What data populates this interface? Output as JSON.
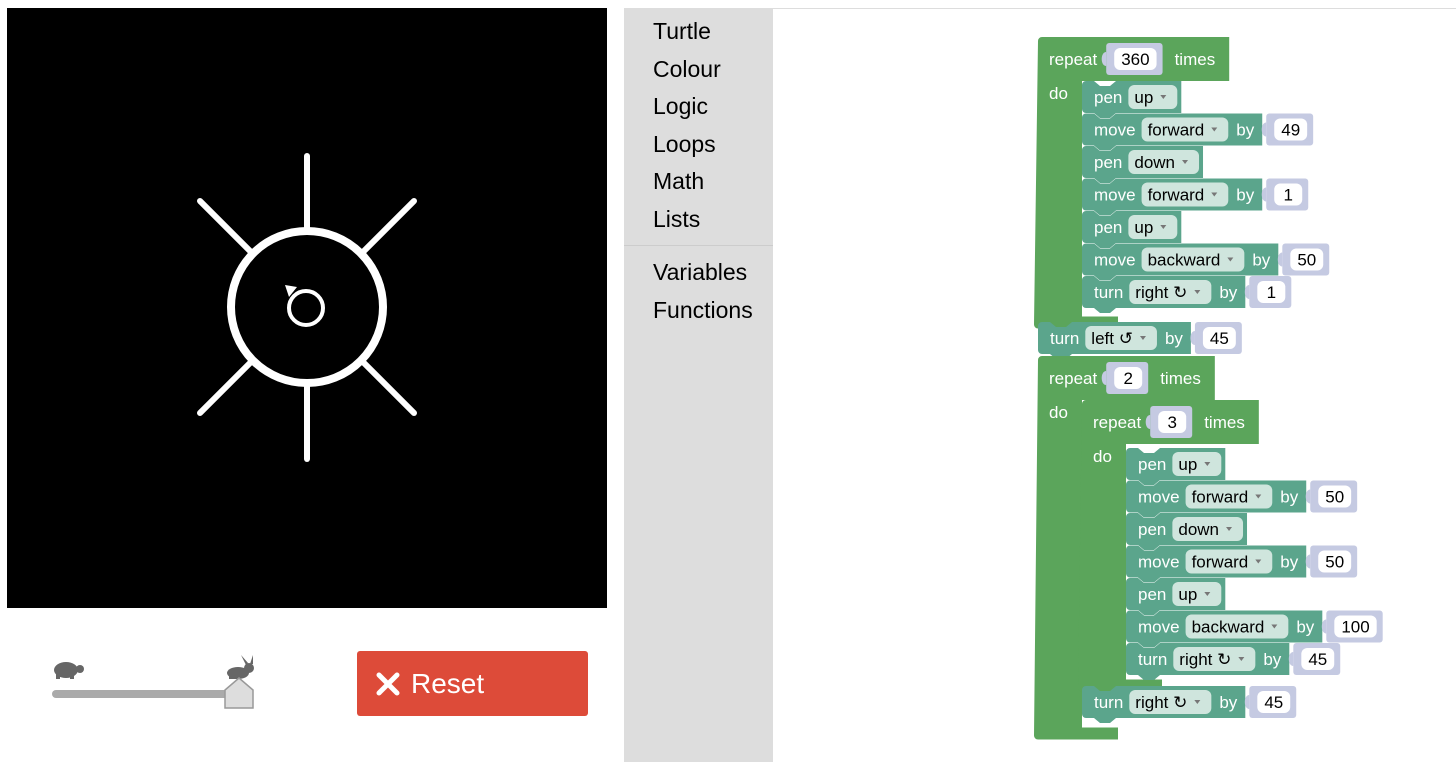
{
  "speed": {
    "slow_icon": "turtle-icon",
    "fast_icon": "rabbit-icon",
    "level": 1.0
  },
  "reset": {
    "label": "Reset",
    "icon": "x-icon"
  },
  "toolbox": {
    "categories": [
      "Turtle",
      "Colour",
      "Logic",
      "Loops",
      "Math",
      "Lists",
      "Variables",
      "Functions"
    ]
  },
  "colors": {
    "loop": "#5ba55b",
    "turtle": "#5ba58c",
    "value": "#c5cae2",
    "dropdown": "#cfe5dd",
    "reset": "#dd4b39",
    "toolbox": "#dddddd",
    "canvas": "#000000"
  },
  "words": {
    "repeat": "repeat",
    "times": "times",
    "do": "do",
    "pen": "pen",
    "move": "move",
    "turn": "turn",
    "by": "by"
  },
  "program": {
    "outer_repeat": {
      "count": "360",
      "body": [
        {
          "verb": "pen",
          "option": "up"
        },
        {
          "verb": "move",
          "option": "forward",
          "by": "49"
        },
        {
          "verb": "pen",
          "option": "down"
        },
        {
          "verb": "move",
          "option": "forward",
          "by": "1"
        },
        {
          "verb": "pen",
          "option": "up"
        },
        {
          "verb": "move",
          "option": "backward",
          "by": "50"
        },
        {
          "verb": "turn",
          "option": "right ↻",
          "by": "1"
        }
      ]
    },
    "turn_left": {
      "verb": "turn",
      "option": "left ↺",
      "by": "45"
    },
    "second_repeat": {
      "count": "2",
      "inner_repeat": {
        "count": "3",
        "body": [
          {
            "verb": "pen",
            "option": "up"
          },
          {
            "verb": "move",
            "option": "forward",
            "by": "50"
          },
          {
            "verb": "pen",
            "option": "down"
          },
          {
            "verb": "move",
            "option": "forward",
            "by": "50"
          },
          {
            "verb": "pen",
            "option": "up"
          },
          {
            "verb": "move",
            "option": "backward",
            "by": "100"
          },
          {
            "verb": "turn",
            "option": "right ↻",
            "by": "45"
          }
        ]
      },
      "after": {
        "verb": "turn",
        "option": "right ↻",
        "by": "45"
      }
    }
  }
}
